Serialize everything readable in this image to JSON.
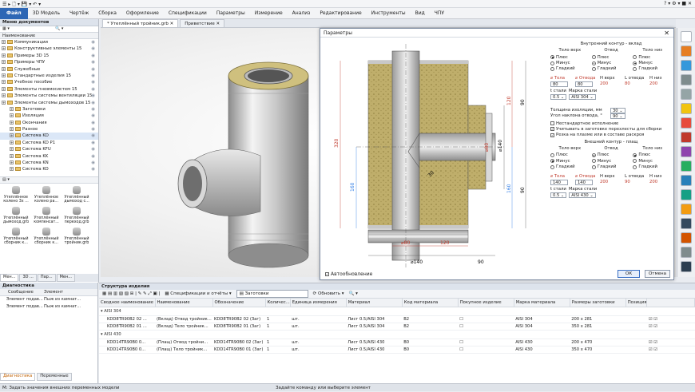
{
  "menu": {
    "file": "Файл",
    "items": [
      "3D Модель",
      "Чертёж",
      "Сборка",
      "Оформление",
      "Спецификации",
      "Параметры",
      "Измерение",
      "Анализ",
      "Редактирование",
      "Инструменты",
      "Вид",
      "ЧПУ"
    ]
  },
  "doc_tabs": [
    "* Утеплённый тройник.grb",
    "Приветствие"
  ],
  "left_panel": {
    "title": "Меню документов",
    "col_header": "Наименование",
    "tree": [
      {
        "label": "Коммуникации",
        "level": 0
      },
      {
        "label": "Конструктивные элементы 15",
        "level": 0
      },
      {
        "label": "Примеры 3D 15",
        "level": 0
      },
      {
        "label": "Примеры ЧПУ",
        "level": 0
      },
      {
        "label": "Служебные",
        "level": 0
      },
      {
        "label": "Стандартные изделия 15",
        "level": 0
      },
      {
        "label": "Учебное пособие",
        "level": 0
      },
      {
        "label": "Элементы пневмосистем 15",
        "level": 0
      },
      {
        "label": "Элементы системы вентиляции 15",
        "level": 0
      },
      {
        "label": "Элементы системы дымоходов 15",
        "level": 0
      },
      {
        "label": "Заготовки",
        "level": 1
      },
      {
        "label": "Изоляция",
        "level": 1
      },
      {
        "label": "Окончания",
        "level": 1
      },
      {
        "label": "Разное",
        "level": 1
      },
      {
        "label": "Система KD",
        "level": 1
      },
      {
        "label": "Система KD P1",
        "level": 1
      },
      {
        "label": "Система KFU",
        "level": 1
      },
      {
        "label": "Система KK",
        "level": 1
      },
      {
        "label": "Система KN",
        "level": 1
      },
      {
        "label": "Система KO",
        "level": 1
      }
    ],
    "thumbs": [
      "Утеплённое колено 3х ...",
      "Утеплённое колено ра...",
      "Утеплённый дымоход с...",
      "Утеплённый дымоход.grb",
      "Утеплённый компенсат...",
      "Утеплённый переход.grb",
      "Утеплённый сборник к...",
      "Утеплённый сборник к...",
      "Утеплённый тройник.grb"
    ],
    "bottom_tabs": [
      "Мен...",
      "3D ...",
      "Пар...",
      "Мен..."
    ]
  },
  "dialog": {
    "title": "Параметры",
    "inner_title": "Внутренний контур - вклад",
    "col_heads": [
      "Тело верх",
      "Отвод",
      "Тело низ"
    ],
    "radios": [
      [
        "Плюс",
        "Минус",
        "Гладкий"
      ],
      [
        "Плюс",
        "Минус",
        "Гладкий"
      ],
      [
        "Плюс",
        "Минус",
        "Гладкий"
      ]
    ],
    "inner_selected": [
      0,
      1,
      1
    ],
    "dims_head": [
      "⌀ Тела",
      "⌀ Отвода",
      "H верх",
      "L отвода",
      "H низ"
    ],
    "inner_dims": [
      "80",
      "80",
      "200",
      "80",
      "200"
    ],
    "t_label": "t стали",
    "mark_label": "Марка стали",
    "inner_t": "0.5",
    "inner_mark": "AISI 304",
    "insul_label": "Толщина изоляции, мм",
    "insul_val": "30",
    "angle_label": "Угол наклона отвода, °",
    "angle_val": "90",
    "checks": [
      {
        "label": "Нестандартное исполнение",
        "checked": false
      },
      {
        "label": "Учитывать в заготовке перехлесты для сборки",
        "checked": true
      },
      {
        "label": "Резка на плазме или в составе раскроя",
        "checked": true
      }
    ],
    "outer_title": "Внешний контур - плащ",
    "outer_selected": [
      1,
      0,
      0
    ],
    "outer_dims": [
      "140",
      "140",
      "200",
      "90",
      "200"
    ],
    "outer_t": "0.5",
    "outer_mark": "AISI 430",
    "auto_update": "Автообновление",
    "ok": "ОК",
    "cancel": "Отмена",
    "drawing_labels": {
      "d80a": "⌀80",
      "d80b": "⌀80",
      "d140a": "⌀140",
      "d140b": "⌀140",
      "h320": "320",
      "h160": "160",
      "r120": "120",
      "r90": "90",
      "r160": "160",
      "r90b": "90",
      "b120": "120",
      "b90": "90",
      "d80s": "⌀80",
      "r30": "30"
    }
  },
  "structure": {
    "title": "Структура изделия",
    "tool_specs": "Спецификации и отчёты",
    "tool_blanks": "Заготовки",
    "tool_refresh": "Обновить",
    "columns": [
      "Сводное наименование",
      "Наименование",
      "Обозначение",
      "Количес...",
      "Единица измерения",
      "Материал",
      "Код материала",
      "Покупное изделие",
      "Марка материала",
      "Размеры заготовки",
      "Позиция"
    ],
    "groups": [
      {
        "name": "AISI 304",
        "rows": [
          [
            "KDD8TR90B2 02 ...",
            "(Вклад) Отвод тройник...",
            "KDD8TR90B2 02 (Заг)",
            "1",
            "шт.",
            "Лист 0.5/AISI 304",
            "B2",
            "",
            "AISI 304",
            "200 x 281",
            ""
          ],
          [
            "KDD8TR90B2 01 ...",
            "(Вклад) Тело тройник...",
            "KDD8TR90B2 01 (Заг)",
            "1",
            "шт.",
            "Лист 0.5/AISI 304",
            "B2",
            "",
            "AISI 304",
            "350 x 281",
            ""
          ]
        ]
      },
      {
        "name": "AISI 430",
        "rows": [
          [
            "KDD14TR90B0 0...",
            "(Плащ) Отвод тройни...",
            "KDD14TR90B0 02 (Заг)",
            "1",
            "шт.",
            "Лист 0.5/AISI 430",
            "B0",
            "",
            "AISI 430",
            "200 x 470",
            ""
          ],
          [
            "KDD14TR90B0 0...",
            "(Плащ) Тело тройник...",
            "KDD14TR90B0 01 (Заг)",
            "1",
            "шт.",
            "Лист 0.5/AISI 430",
            "B0",
            "",
            "AISI 430",
            "350 x 470",
            ""
          ]
        ]
      }
    ]
  },
  "diag": {
    "title": "Диагностика",
    "cols": [
      "Сообщение",
      "Элемент"
    ],
    "rows": [
      [
        "Элемент подав...",
        "Пыж из камнат..."
      ],
      [
        "Элемент подав...",
        "Пыж из камнат..."
      ]
    ],
    "tabs": [
      "Диагностика",
      "Переменные"
    ]
  },
  "status": {
    "left": "М: Задать значения внешних переменных модели",
    "center": "Задайте команду или выберите элемент"
  }
}
